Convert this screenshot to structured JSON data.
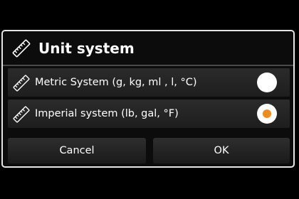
{
  "dialog": {
    "title": "Unit system",
    "title_icon": "ruler-icon",
    "options": [
      {
        "label": "Metric System (g, kg, ml , l, °C)",
        "icon": "ruler-icon",
        "selected": false
      },
      {
        "label": "Imperial system (lb, gal, °F)",
        "icon": "ruler-icon",
        "selected": true
      }
    ],
    "buttons": {
      "cancel_label": "Cancel",
      "ok_label": "OK"
    }
  },
  "colors": {
    "background": "#000000",
    "dialog_border": "#e6e6e6",
    "radio_selected": "#f08c1c",
    "radio_fill": "#ffffff"
  }
}
